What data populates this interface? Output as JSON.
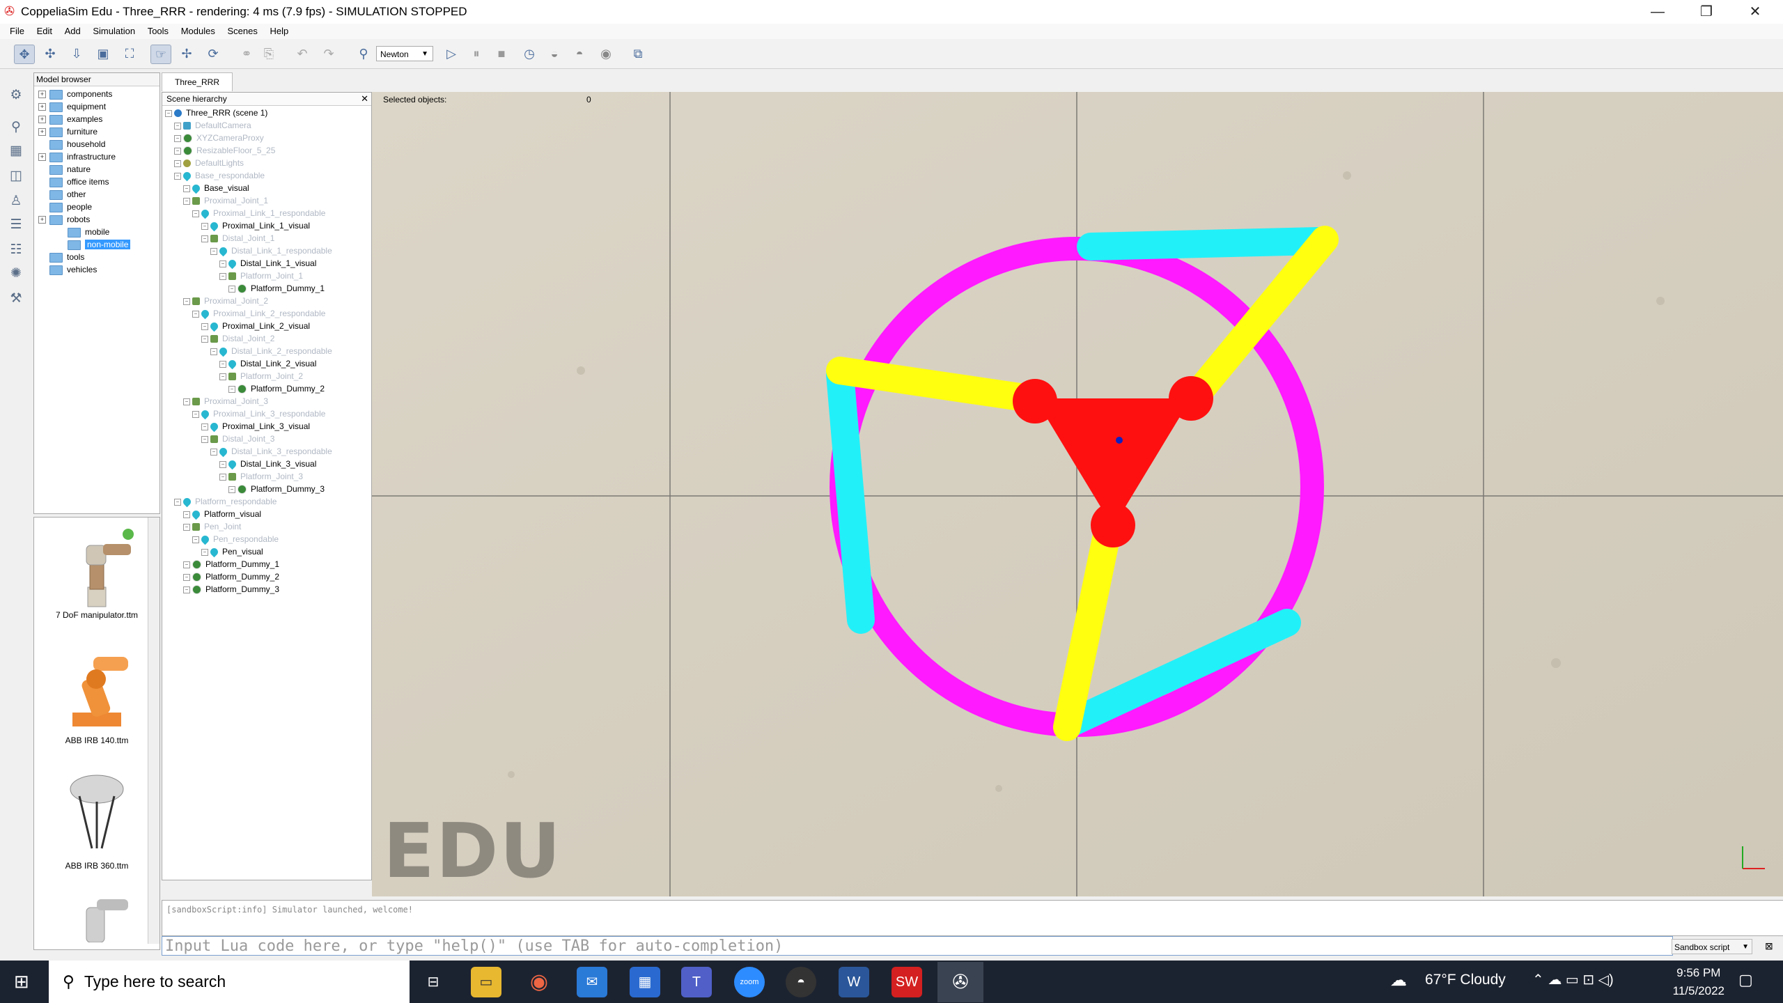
{
  "window": {
    "title": "CoppeliaSim Edu - Three_RRR - rendering: 4 ms (7.9 fps) - SIMULATION STOPPED"
  },
  "menu": [
    "File",
    "Edit",
    "Add",
    "Simulation",
    "Tools",
    "Modules",
    "Scenes",
    "Help"
  ],
  "toolbar": {
    "engine": "Newton"
  },
  "model_browser": {
    "title": "Model browser",
    "items": [
      {
        "label": "components",
        "depth": 0,
        "expandable": true
      },
      {
        "label": "equipment",
        "depth": 0,
        "expandable": true
      },
      {
        "label": "examples",
        "depth": 0,
        "expandable": true
      },
      {
        "label": "furniture",
        "depth": 0,
        "expandable": true
      },
      {
        "label": "household",
        "depth": 0,
        "expandable": false
      },
      {
        "label": "infrastructure",
        "depth": 0,
        "expandable": true
      },
      {
        "label": "nature",
        "depth": 0,
        "expandable": false
      },
      {
        "label": "office items",
        "depth": 0,
        "expandable": false
      },
      {
        "label": "other",
        "depth": 0,
        "expandable": false
      },
      {
        "label": "people",
        "depth": 0,
        "expandable": false
      },
      {
        "label": "robots",
        "depth": 0,
        "expandable": true
      },
      {
        "label": "mobile",
        "depth": 1,
        "expandable": false
      },
      {
        "label": "non-mobile",
        "depth": 1,
        "expandable": false,
        "selected": true
      },
      {
        "label": "tools",
        "depth": 0,
        "expandable": false
      },
      {
        "label": "vehicles",
        "depth": 0,
        "expandable": false
      }
    ],
    "models": [
      "7 DoF manipulator.ttm",
      "ABB IRB 140.ttm",
      "ABB IRB 360.ttm"
    ]
  },
  "scene": {
    "tab": "Three_RRR",
    "hierarchy_title": "Scene hierarchy",
    "items": [
      {
        "label": "Three_RRR (scene 1)",
        "depth": 0,
        "type": "scene",
        "dim": false
      },
      {
        "label": "DefaultCamera",
        "depth": 1,
        "type": "cam",
        "dim": true
      },
      {
        "label": "XYZCameraProxy",
        "depth": 1,
        "type": "dummy",
        "dim": true
      },
      {
        "label": "ResizableFloor_5_25",
        "depth": 1,
        "type": "dummy",
        "dim": true
      },
      {
        "label": "DefaultLights",
        "depth": 1,
        "type": "light",
        "dim": true
      },
      {
        "label": "Base_respondable",
        "depth": 1,
        "type": "shape",
        "dim": true
      },
      {
        "label": "Base_visual",
        "depth": 2,
        "type": "shape",
        "dim": false
      },
      {
        "label": "Proximal_Joint_1",
        "depth": 2,
        "type": "joint",
        "dim": true
      },
      {
        "label": "Proximal_Link_1_respondable",
        "depth": 3,
        "type": "shape",
        "dim": true
      },
      {
        "label": "Proximal_Link_1_visual",
        "depth": 4,
        "type": "shape",
        "dim": false
      },
      {
        "label": "Distal_Joint_1",
        "depth": 4,
        "type": "joint",
        "dim": true
      },
      {
        "label": "Distal_Link_1_respondable",
        "depth": 5,
        "type": "shape",
        "dim": true
      },
      {
        "label": "Distal_Link_1_visual",
        "depth": 6,
        "type": "shape",
        "dim": false
      },
      {
        "label": "Platform_Joint_1",
        "depth": 6,
        "type": "joint",
        "dim": true
      },
      {
        "label": "Platform_Dummy_1",
        "depth": 7,
        "type": "dummy",
        "dim": false
      },
      {
        "label": "Proximal_Joint_2",
        "depth": 2,
        "type": "joint",
        "dim": true
      },
      {
        "label": "Proximal_Link_2_respondable",
        "depth": 3,
        "type": "shape",
        "dim": true
      },
      {
        "label": "Proximal_Link_2_visual",
        "depth": 4,
        "type": "shape",
        "dim": false
      },
      {
        "label": "Distal_Joint_2",
        "depth": 4,
        "type": "joint",
        "dim": true
      },
      {
        "label": "Distal_Link_2_respondable",
        "depth": 5,
        "type": "shape",
        "dim": true
      },
      {
        "label": "Distal_Link_2_visual",
        "depth": 6,
        "type": "shape",
        "dim": false
      },
      {
        "label": "Platform_Joint_2",
        "depth": 6,
        "type": "joint",
        "dim": true
      },
      {
        "label": "Platform_Dummy_2",
        "depth": 7,
        "type": "dummy",
        "dim": false
      },
      {
        "label": "Proximal_Joint_3",
        "depth": 2,
        "type": "joint",
        "dim": true
      },
      {
        "label": "Proximal_Link_3_respondable",
        "depth": 3,
        "type": "shape",
        "dim": true
      },
      {
        "label": "Proximal_Link_3_visual",
        "depth": 4,
        "type": "shape",
        "dim": false
      },
      {
        "label": "Distal_Joint_3",
        "depth": 4,
        "type": "joint",
        "dim": true
      },
      {
        "label": "Distal_Link_3_respondable",
        "depth": 5,
        "type": "shape",
        "dim": true
      },
      {
        "label": "Distal_Link_3_visual",
        "depth": 6,
        "type": "shape",
        "dim": false
      },
      {
        "label": "Platform_Joint_3",
        "depth": 6,
        "type": "joint",
        "dim": true
      },
      {
        "label": "Platform_Dummy_3",
        "depth": 7,
        "type": "dummy",
        "dim": false
      },
      {
        "label": "Platform_respondable",
        "depth": 1,
        "type": "shape",
        "dim": true
      },
      {
        "label": "Platform_visual",
        "depth": 2,
        "type": "shape",
        "dim": false
      },
      {
        "label": "Pen_Joint",
        "depth": 2,
        "type": "joint",
        "dim": true
      },
      {
        "label": "Pen_respondable",
        "depth": 3,
        "type": "shape",
        "dim": true
      },
      {
        "label": "Pen_visual",
        "depth": 4,
        "type": "shape",
        "dim": false
      },
      {
        "label": "Platform_Dummy_1",
        "depth": 2,
        "type": "dummy",
        "dim": false
      },
      {
        "label": "Platform_Dummy_2",
        "depth": 2,
        "type": "dummy",
        "dim": false
      },
      {
        "label": "Platform_Dummy_3",
        "depth": 2,
        "type": "dummy",
        "dim": false
      }
    ]
  },
  "viewport": {
    "selected_label": "Selected objects:",
    "selected_count": "0",
    "watermark": "EDU"
  },
  "console": {
    "message": "[sandboxScript:info] Simulator launched, welcome!",
    "placeholder": "Input Lua code here, or type \"help()\" (use TAB for auto-completion)",
    "script_selector": "Sandbox script"
  },
  "taskbar": {
    "search_placeholder": "Type here to search",
    "weather": "67°F  Cloudy",
    "time": "9:56 PM",
    "date": "11/5/2022"
  }
}
